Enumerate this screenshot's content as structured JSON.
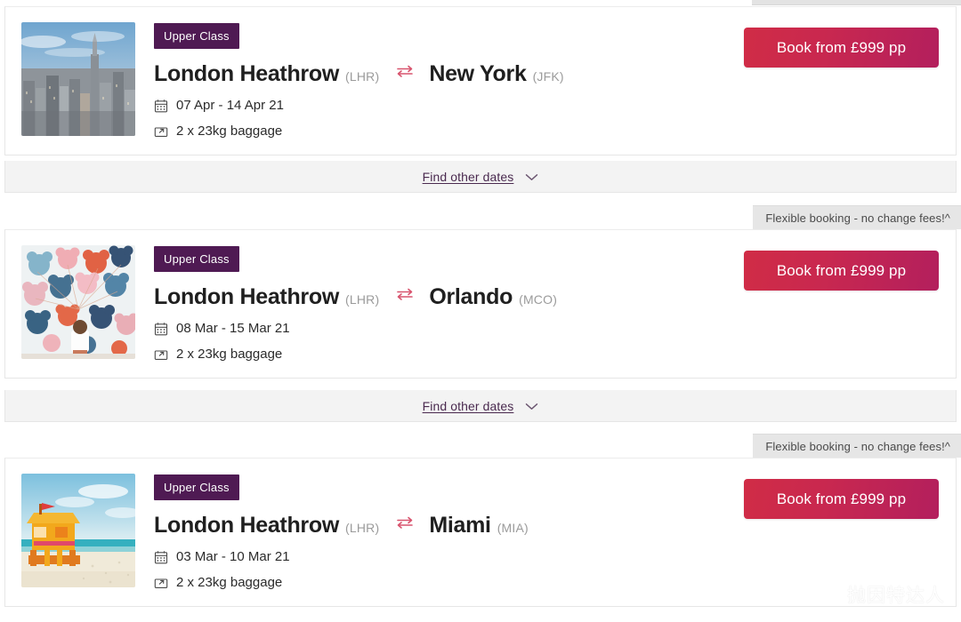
{
  "badges": {
    "flexible": "Flexible booking - no change fees!^"
  },
  "links": {
    "find_other_dates": "Find other dates"
  },
  "watermark": {
    "text": "抛因特达人",
    "icon": "wechat-icon"
  },
  "colors": {
    "class_badge_bg": "#4f1a53",
    "button_gradient_start": "#d02c46",
    "button_gradient_end": "#b31f5d",
    "strip_bg": "#f3f3f3",
    "flex_badge_bg": "#e6e6e6",
    "link_color": "#4a2a4f"
  },
  "offers": [
    {
      "class_label": "Upper Class",
      "origin_city": "London Heathrow",
      "origin_code": "(LHR)",
      "destination_city": "New York",
      "destination_code": "(JFK)",
      "dates": "07 Apr - 14 Apr 21",
      "baggage": "2 x 23kg baggage",
      "button_label": "Book from £999 pp",
      "thumbnail": "new-york-skyline-photo"
    },
    {
      "class_label": "Upper Class",
      "origin_city": "London Heathrow",
      "origin_code": "(LHR)",
      "destination_city": "Orlando",
      "destination_code": "(MCO)",
      "dates": "08 Mar - 15 Mar 21",
      "baggage": "2 x 23kg baggage",
      "button_label": "Book from £999 pp",
      "thumbnail": "orlando-balloons-photo"
    },
    {
      "class_label": "Upper Class",
      "origin_city": "London Heathrow",
      "origin_code": "(LHR)",
      "destination_city": "Miami",
      "destination_code": "(MIA)",
      "dates": "03 Mar - 10 Mar 21",
      "baggage": "2 x 23kg baggage",
      "button_label": "Book from £999 pp",
      "thumbnail": "miami-lifeguard-tower-photo"
    }
  ]
}
